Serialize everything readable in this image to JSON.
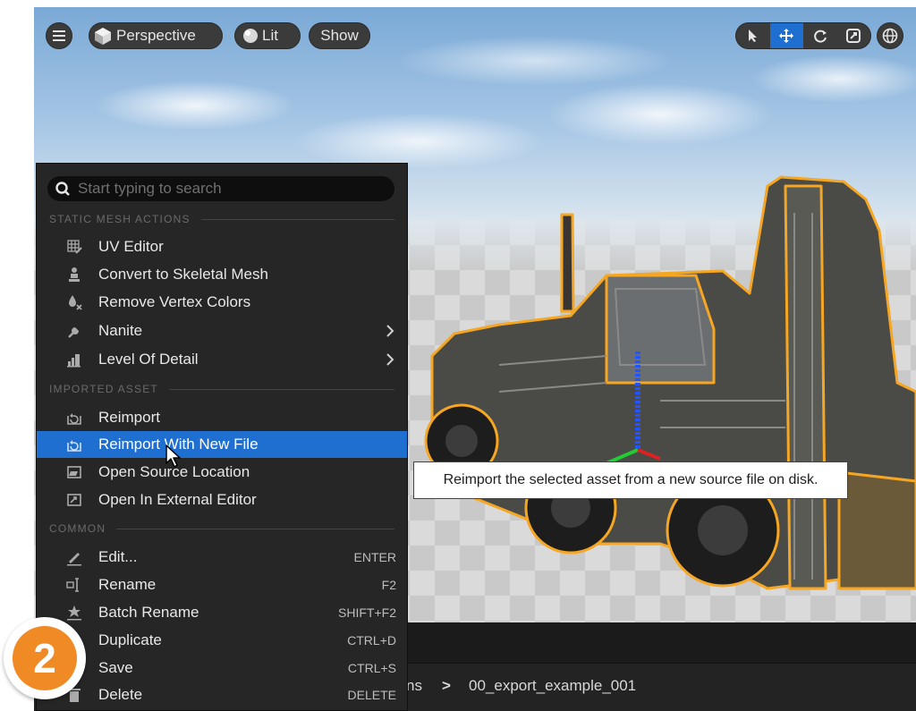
{
  "toolbar": {
    "perspective_label": "Perspective",
    "lit_label": "Lit",
    "show_label": "Show"
  },
  "menu": {
    "search_placeholder": "Start typing to search",
    "sections": {
      "static_mesh": "STATIC MESH ACTIONS",
      "imported_asset": "IMPORTED ASSET",
      "common": "COMMON"
    },
    "items": {
      "uv_editor": "UV Editor",
      "convert_skeletal": "Convert to Skeletal Mesh",
      "remove_vertex_colors": "Remove Vertex Colors",
      "nanite": "Nanite",
      "level_of_detail": "Level Of Detail",
      "reimport": "Reimport",
      "reimport_new_file": "Reimport With New File",
      "open_source_location": "Open Source Location",
      "open_external_editor": "Open In External Editor",
      "edit": "Edit...",
      "edit_shortcut": "ENTER",
      "rename": "Rename",
      "rename_shortcut": "F2",
      "batch_rename": "Batch Rename",
      "batch_rename_shortcut": "SHIFT+F2",
      "duplicate": "Duplicate",
      "duplicate_shortcut": "CTRL+D",
      "save": "Save",
      "save_shortcut": "CTRL+S",
      "delete": "Delete",
      "delete_shortcut": "DELETE"
    }
  },
  "tooltip": "Reimport the selected asset from a new source file on disk.",
  "path": {
    "partial": "ns",
    "separator": ">",
    "current": "00_export_example_001"
  },
  "step_badge": "2",
  "colors": {
    "highlight": "#1f6fd1",
    "selection_outline": "#f5a623",
    "badge": "#f08a25"
  }
}
